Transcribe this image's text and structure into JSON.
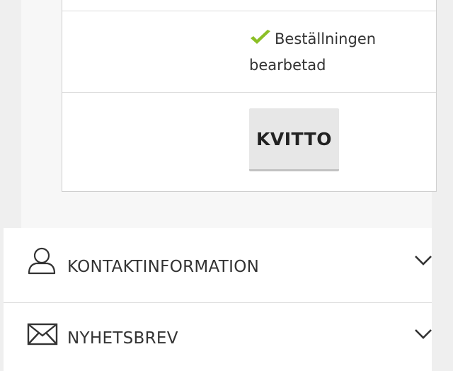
{
  "order": {
    "status_text": "Beställningen bearbetad",
    "receipt_label": "KVITTO"
  },
  "accordion": {
    "contact_label": "KONTAKTINFORMATION",
    "newsletter_label": "NYHETSBREV"
  },
  "colors": {
    "check": "#8cbf26",
    "button_bg": "#e7e7e7",
    "border": "#dcdcdc"
  },
  "icons": {
    "status": "check-icon",
    "contact": "user-icon",
    "newsletter": "envelope-icon",
    "expand": "chevron-down-icon"
  }
}
